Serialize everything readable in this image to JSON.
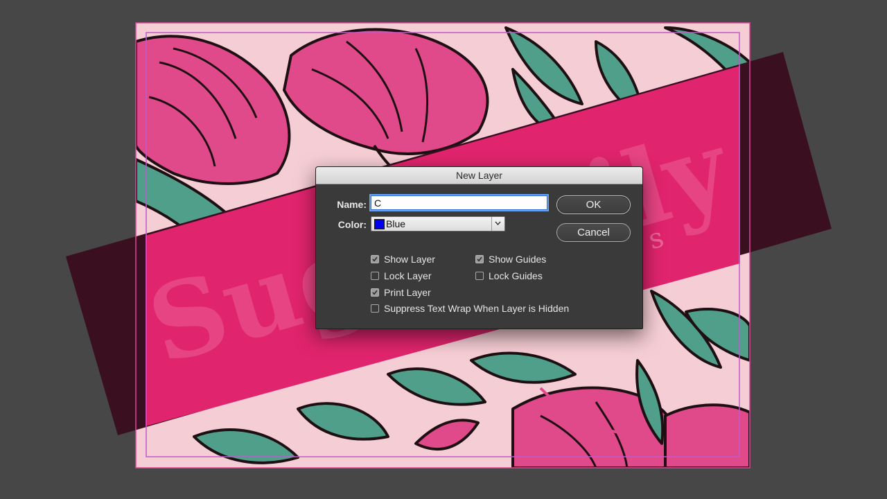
{
  "dialog": {
    "title": "New Layer",
    "name_label": "Name:",
    "name_value": "C",
    "color_label": "Color:",
    "color_value": "Blue",
    "color_swatch": "#0000ee",
    "ok_label": "OK",
    "cancel_label": "Cancel",
    "options": {
      "show_layer": {
        "label": "Show Layer",
        "checked": true
      },
      "lock_layer": {
        "label": "Lock Layer",
        "checked": false
      },
      "print_layer": {
        "label": "Print Layer",
        "checked": true
      },
      "suppress_wrap": {
        "label": "Suppress Text Wrap When Layer is Hidden",
        "checked": false
      },
      "show_guides": {
        "label": "Show Guides",
        "checked": true
      },
      "lock_guides": {
        "label": "Lock Guides",
        "checked": false
      }
    }
  },
  "artwork": {
    "logo_text": "Sugar Lily",
    "logo_subtext": "k e s",
    "colors": {
      "pasteboard": "#474747",
      "paper": "#f5cdd4",
      "band_dark": "#3a0f20",
      "band_pink": "#e0246d",
      "flower": "#e0498a",
      "leaf": "#4f9f8a",
      "outline": "#1e0f12",
      "frame": "#e0469a"
    }
  }
}
